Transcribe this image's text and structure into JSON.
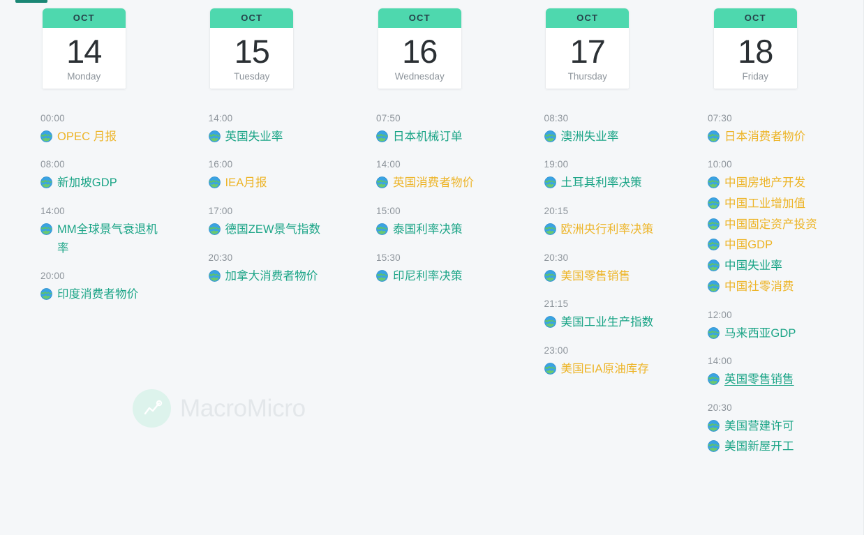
{
  "app": {
    "watermark_text": "MacroMicro",
    "accent_green": "#4ed8ae",
    "event_teal": "#1aa486",
    "event_amber": "#edb427",
    "background": "#f5f7f9"
  },
  "calendar": {
    "days": [
      {
        "month": "OCT",
        "day": "14",
        "weekday": "Monday",
        "groups": [
          {
            "time": "00:00",
            "events": [
              {
                "name": "OPEC 月报",
                "importance": "amber",
                "icon": "globe-icon",
                "hovered": false
              }
            ]
          },
          {
            "time": "08:00",
            "events": [
              {
                "name": "新加坡GDP",
                "importance": "teal",
                "icon": "globe-icon",
                "hovered": false
              }
            ]
          },
          {
            "time": "14:00",
            "events": [
              {
                "name": "MM全球景气衰退机率",
                "importance": "teal",
                "icon": "globe-icon",
                "hovered": false
              }
            ]
          },
          {
            "time": "20:00",
            "events": [
              {
                "name": "印度消费者物价",
                "importance": "teal",
                "icon": "globe-icon",
                "hovered": false
              }
            ]
          }
        ]
      },
      {
        "month": "OCT",
        "day": "15",
        "weekday": "Tuesday",
        "groups": [
          {
            "time": "14:00",
            "events": [
              {
                "name": "英国失业率",
                "importance": "teal",
                "icon": "globe-icon",
                "hovered": false
              }
            ]
          },
          {
            "time": "16:00",
            "events": [
              {
                "name": "IEA月报",
                "importance": "amber",
                "icon": "globe-icon",
                "hovered": false
              }
            ]
          },
          {
            "time": "17:00",
            "events": [
              {
                "name": "德国ZEW景气指数",
                "importance": "teal",
                "icon": "globe-icon",
                "hovered": false
              }
            ]
          },
          {
            "time": "20:30",
            "events": [
              {
                "name": "加拿大消费者物价",
                "importance": "teal",
                "icon": "globe-icon",
                "hovered": false
              }
            ]
          }
        ]
      },
      {
        "month": "OCT",
        "day": "16",
        "weekday": "Wednesday",
        "groups": [
          {
            "time": "07:50",
            "events": [
              {
                "name": "日本机械订单",
                "importance": "teal",
                "icon": "globe-icon",
                "hovered": false
              }
            ]
          },
          {
            "time": "14:00",
            "events": [
              {
                "name": "英国消费者物价",
                "importance": "amber",
                "icon": "globe-icon",
                "hovered": false
              }
            ]
          },
          {
            "time": "15:00",
            "events": [
              {
                "name": "泰国利率决策",
                "importance": "teal",
                "icon": "globe-icon",
                "hovered": false
              }
            ]
          },
          {
            "time": "15:30",
            "events": [
              {
                "name": "印尼利率决策",
                "importance": "teal",
                "icon": "globe-icon",
                "hovered": false
              }
            ]
          }
        ]
      },
      {
        "month": "OCT",
        "day": "17",
        "weekday": "Thursday",
        "groups": [
          {
            "time": "08:30",
            "events": [
              {
                "name": "澳洲失业率",
                "importance": "teal",
                "icon": "globe-icon",
                "hovered": false
              }
            ]
          },
          {
            "time": "19:00",
            "events": [
              {
                "name": "土耳其利率决策",
                "importance": "teal",
                "icon": "globe-icon",
                "hovered": false
              }
            ]
          },
          {
            "time": "20:15",
            "events": [
              {
                "name": "欧洲央行利率决策",
                "importance": "amber",
                "icon": "globe-icon",
                "hovered": false
              }
            ]
          },
          {
            "time": "20:30",
            "events": [
              {
                "name": "美国零售销售",
                "importance": "amber",
                "icon": "globe-icon",
                "hovered": false
              }
            ]
          },
          {
            "time": "21:15",
            "events": [
              {
                "name": "美国工业生产指数",
                "importance": "teal",
                "icon": "globe-icon",
                "hovered": false
              }
            ]
          },
          {
            "time": "23:00",
            "events": [
              {
                "name": "美国EIA原油库存",
                "importance": "amber",
                "icon": "globe-icon",
                "hovered": false
              }
            ]
          }
        ]
      },
      {
        "month": "OCT",
        "day": "18",
        "weekday": "Friday",
        "groups": [
          {
            "time": "07:30",
            "events": [
              {
                "name": "日本消费者物价",
                "importance": "amber",
                "icon": "globe-icon",
                "hovered": false
              }
            ]
          },
          {
            "time": "10:00",
            "events": [
              {
                "name": "中国房地产开发",
                "importance": "amber",
                "icon": "globe-icon",
                "hovered": false
              },
              {
                "name": "中国工业增加值",
                "importance": "amber",
                "icon": "globe-icon",
                "hovered": false
              },
              {
                "name": "中国固定资产投资",
                "importance": "amber",
                "icon": "globe-icon",
                "hovered": false
              },
              {
                "name": "中国GDP",
                "importance": "amber",
                "icon": "globe-icon",
                "hovered": false
              },
              {
                "name": "中国失业率",
                "importance": "teal",
                "icon": "globe-icon",
                "hovered": false
              },
              {
                "name": "中国社零消费",
                "importance": "amber",
                "icon": "globe-icon",
                "hovered": false
              }
            ]
          },
          {
            "time": "12:00",
            "events": [
              {
                "name": "马来西亚GDP",
                "importance": "teal",
                "icon": "globe-icon",
                "hovered": false
              }
            ]
          },
          {
            "time": "14:00",
            "events": [
              {
                "name": "英国零售销售",
                "importance": "teal",
                "icon": "globe-icon",
                "hovered": true
              }
            ]
          },
          {
            "time": "20:30",
            "events": [
              {
                "name": "美国营建许可",
                "importance": "teal",
                "icon": "globe-icon",
                "hovered": false
              },
              {
                "name": "美国新屋开工",
                "importance": "teal",
                "icon": "globe-icon",
                "hovered": false
              }
            ]
          }
        ]
      }
    ]
  }
}
